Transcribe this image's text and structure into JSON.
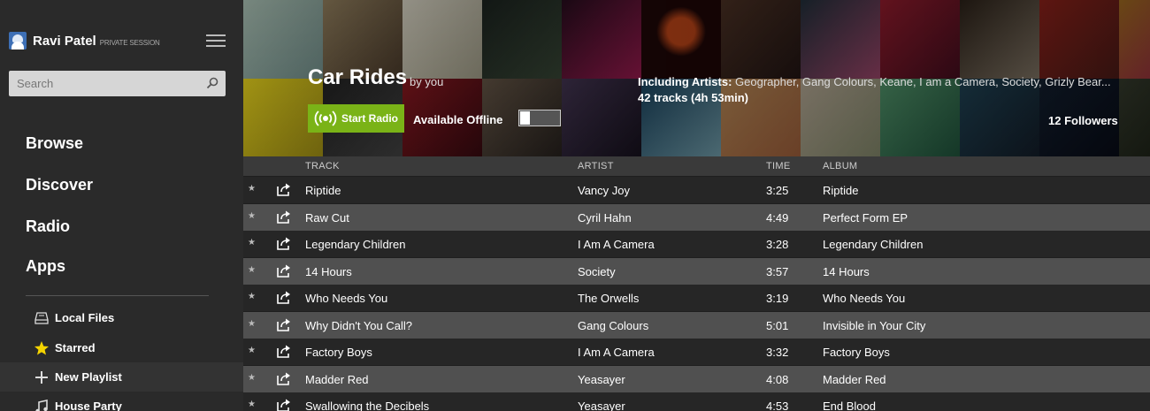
{
  "user": {
    "name": "Ravi Patel",
    "session": "PRIVATE SESSION"
  },
  "search": {
    "placeholder": "Search"
  },
  "nav": [
    "Browse",
    "Discover",
    "Radio",
    "Apps"
  ],
  "library": [
    {
      "label": "Local Files",
      "icon": "hard-drive-icon"
    },
    {
      "label": "Starred",
      "icon": "star-icon"
    },
    {
      "label": "New Playlist",
      "icon": "plus-icon"
    },
    {
      "label": "House Party",
      "icon": "music-note-icon"
    }
  ],
  "playlist": {
    "title": "Car Rides",
    "byline": "by you",
    "radio_label": "Start Radio",
    "offline_label": "Available Offline",
    "offline_enabled": false,
    "including_label": "Including Artists:",
    "including_artists": "Geographer, Gang Colours, Keane, I am a Camera, Society, Grizly Bear...",
    "tracks_info": "42 tracks (4h 53min)",
    "followers": "12 Followers"
  },
  "colors": {
    "accent": "#7ab317",
    "sidebar": "#2a2a2a",
    "row_alt": "#505050"
  },
  "columns": {
    "track": "TRACK",
    "artist": "ARTIST",
    "time": "TIME",
    "album": "ALBUM"
  },
  "tracks": [
    {
      "track": "Riptide",
      "artist": "Vancy Joy",
      "time": "3:25",
      "album": "Riptide"
    },
    {
      "track": "Raw Cut",
      "artist": "Cyril Hahn",
      "time": "4:49",
      "album": "Perfect Form EP"
    },
    {
      "track": "Legendary Children",
      "artist": "I Am A Camera",
      "time": "3:28",
      "album": "Legendary Children"
    },
    {
      "track": "14 Hours",
      "artist": "Society",
      "time": "3:57",
      "album": "14 Hours"
    },
    {
      "track": "Who Needs You",
      "artist": "The Orwells",
      "time": "3:19",
      "album": "Who Needs You"
    },
    {
      "track": "Why Didn't You Call?",
      "artist": "Gang Colours",
      "time": "5:01",
      "album": "Invisible in Your City"
    },
    {
      "track": "Factory Boys",
      "artist": "I Am A Camera",
      "time": "3:32",
      "album": "Factory Boys"
    },
    {
      "track": "Madder Red",
      "artist": "Yeasayer",
      "time": "4:08",
      "album": "Madder Red"
    },
    {
      "track": "Swallowing the Decibels",
      "artist": "Yeasayer",
      "time": "4:53",
      "album": "End Blood"
    }
  ]
}
